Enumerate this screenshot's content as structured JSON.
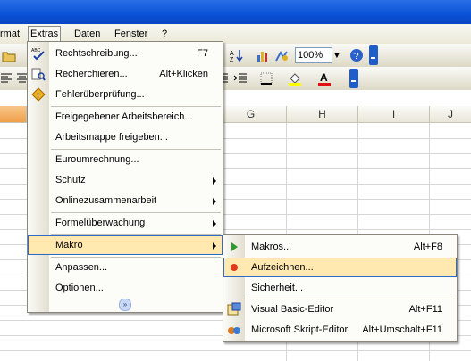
{
  "menubar": {
    "items": [
      {
        "label": "rmat"
      },
      {
        "label": "Extras"
      },
      {
        "label": "Daten"
      },
      {
        "label": "Fenster"
      },
      {
        "label": "?"
      }
    ]
  },
  "toolbar": {
    "zoom": "100%"
  },
  "columns": [
    "G",
    "H",
    "I",
    "J"
  ],
  "extras_menu": {
    "items": [
      {
        "label": "Rechtschreibung...",
        "shortcut": "F7",
        "icon": "spellcheck-icon"
      },
      {
        "label": "Recherchieren...",
        "shortcut": "Alt+Klicken",
        "icon": "research-icon"
      },
      {
        "label": "Fehlerüberprüfung...",
        "icon": "error-check-icon"
      },
      {
        "label": "Freigegebener Arbeitsbereich..."
      },
      {
        "label": "Arbeitsmappe freigeben..."
      },
      {
        "label": "Euroumrechnung..."
      },
      {
        "label": "Schutz",
        "submenu": true
      },
      {
        "label": "Onlinezusammenarbeit",
        "submenu": true
      },
      {
        "label": "Formelüberwachung",
        "submenu": true
      },
      {
        "label": "Makro",
        "submenu": true,
        "highlighted": true
      },
      {
        "label": "Anpassen..."
      },
      {
        "label": "Optionen..."
      }
    ]
  },
  "makro_menu": {
    "items": [
      {
        "label": "Makros...",
        "shortcut": "Alt+F8",
        "icon": "play-macro-icon"
      },
      {
        "label": "Aufzeichnen...",
        "icon": "record-icon",
        "highlighted": true
      },
      {
        "label": "Sicherheit..."
      },
      {
        "label": "Visual Basic-Editor",
        "shortcut": "Alt+F11",
        "icon": "vb-editor-icon"
      },
      {
        "label": "Microsoft Skript-Editor",
        "shortcut": "Alt+Umschalt+F11",
        "icon": "script-editor-icon"
      }
    ]
  }
}
